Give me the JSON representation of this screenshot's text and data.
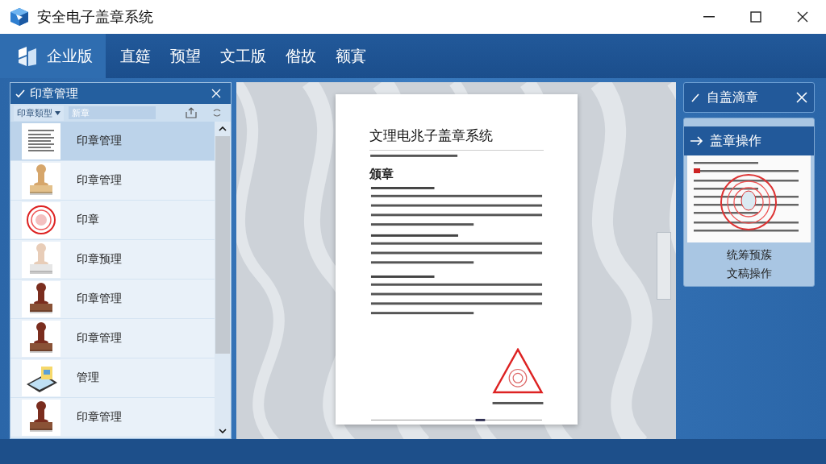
{
  "window": {
    "title": "安全电子盖章系统"
  },
  "menubar": {
    "items": [
      {
        "label": "企业版",
        "kind": "brand",
        "selected": true
      },
      {
        "label": "直筵",
        "kind": "menu",
        "selected": false
      },
      {
        "label": "预望",
        "kind": "menu",
        "selected": false
      },
      {
        "label": "文工版",
        "kind": "menu",
        "selected": false
      },
      {
        "label": "偺故",
        "kind": "menu",
        "selected": false
      },
      {
        "label": "额寘",
        "kind": "menu",
        "selected": false
      }
    ]
  },
  "left_panel": {
    "title": "印章管理",
    "filter": "印章類型",
    "search": {
      "placeholder": "新章"
    },
    "items": [
      {
        "label": "印章管理",
        "kind": "document",
        "selected": true
      },
      {
        "label": "印章管理",
        "kind": "wood-stamp",
        "selected": false
      },
      {
        "label": "印章",
        "kind": "red-seal",
        "selected": false
      },
      {
        "label": "印章预理",
        "kind": "white-stamp",
        "selected": false
      },
      {
        "label": "印章管理",
        "kind": "dark-stamp",
        "selected": false
      },
      {
        "label": "印章管理",
        "kind": "dark-stamp",
        "selected": false
      },
      {
        "label": "管理",
        "kind": "tablet",
        "selected": false
      },
      {
        "label": "印章管理",
        "kind": "dark-stamp",
        "selected": false
      }
    ]
  },
  "document": {
    "title": "文理电兆子盖章系统",
    "heading": "颁章"
  },
  "right_panel": {
    "title": "自盖滴章",
    "card": {
      "title": "盖章操作",
      "captions": [
        "统筹预蔟",
        "文稿操作"
      ]
    }
  }
}
